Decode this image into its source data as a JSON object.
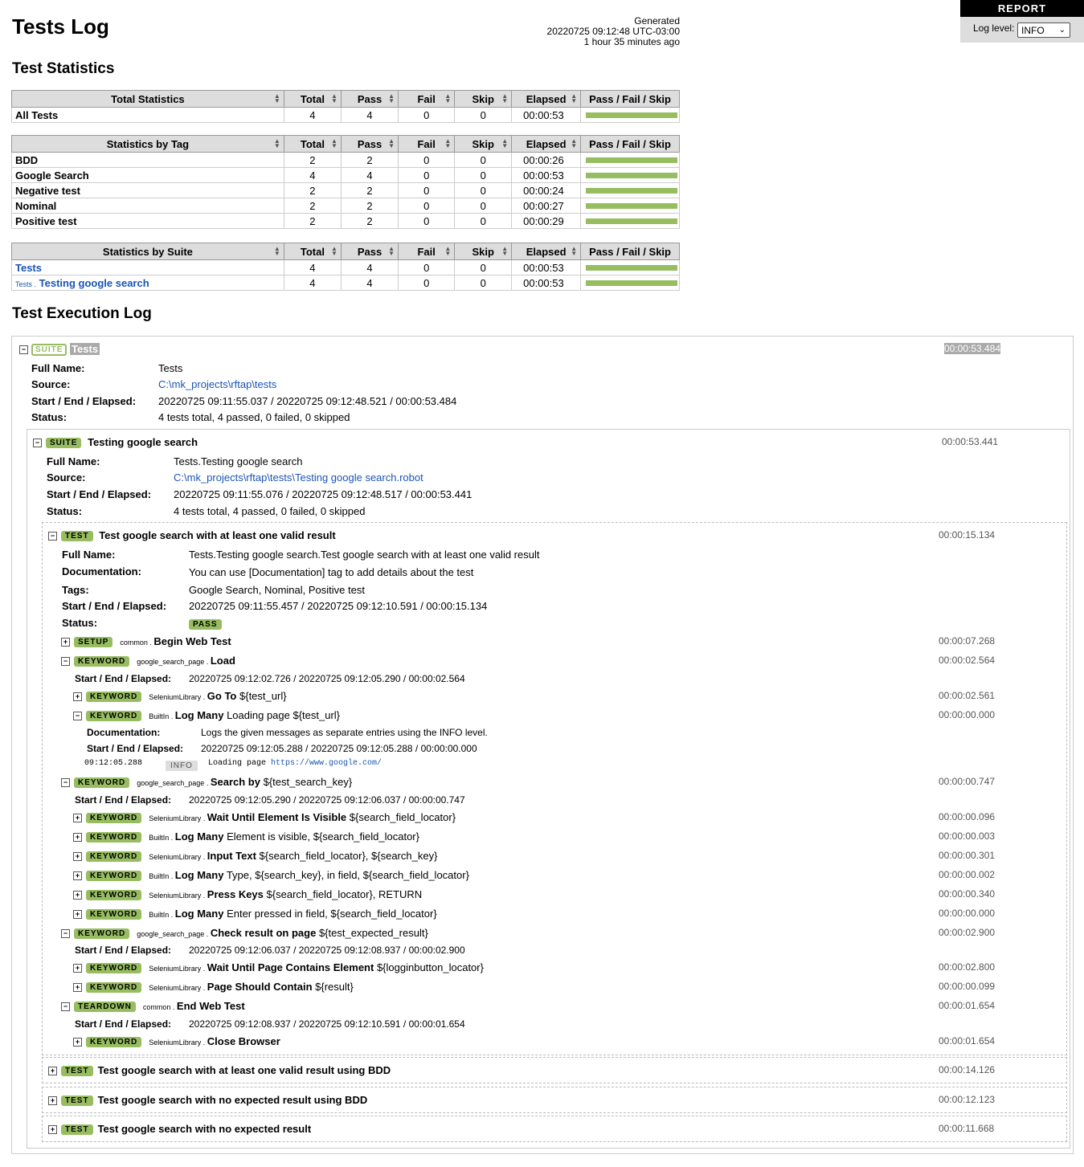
{
  "header": {
    "title": "Tests Log",
    "generated_label": "Generated",
    "generated_time": "20220725 09:12:48 UTC-03:00",
    "generated_ago": "1 hour 35 minutes ago",
    "report_link": "REPORT",
    "log_level_label": "Log level:",
    "log_level_value": "INFO"
  },
  "statistics": {
    "heading": "Test Statistics",
    "columns": [
      "Total",
      "Pass",
      "Fail",
      "Skip",
      "Elapsed",
      "Pass / Fail / Skip"
    ],
    "total": {
      "heading": "Total Statistics",
      "rows": [
        {
          "name": "All Tests",
          "total": "4",
          "pass": "4",
          "fail": "0",
          "skip": "0",
          "elapsed": "00:00:53",
          "pass_ratio": 1.0
        }
      ]
    },
    "by_tag": {
      "heading": "Statistics by Tag",
      "rows": [
        {
          "name": "BDD",
          "total": "2",
          "pass": "2",
          "fail": "0",
          "skip": "0",
          "elapsed": "00:00:26",
          "pass_ratio": 1.0
        },
        {
          "name": "Google Search",
          "total": "4",
          "pass": "4",
          "fail": "0",
          "skip": "0",
          "elapsed": "00:00:53",
          "pass_ratio": 1.0
        },
        {
          "name": "Negative test",
          "total": "2",
          "pass": "2",
          "fail": "0",
          "skip": "0",
          "elapsed": "00:00:24",
          "pass_ratio": 1.0
        },
        {
          "name": "Nominal",
          "total": "2",
          "pass": "2",
          "fail": "0",
          "skip": "0",
          "elapsed": "00:00:27",
          "pass_ratio": 1.0
        },
        {
          "name": "Positive test",
          "total": "2",
          "pass": "2",
          "fail": "0",
          "skip": "0",
          "elapsed": "00:00:29",
          "pass_ratio": 1.0
        }
      ]
    },
    "by_suite": {
      "heading": "Statistics by Suite",
      "rows": [
        {
          "prefix": "",
          "name": "Tests",
          "total": "4",
          "pass": "4",
          "fail": "0",
          "skip": "0",
          "elapsed": "00:00:53",
          "pass_ratio": 1.0
        },
        {
          "prefix": "Tests .",
          "name": "Testing google search",
          "total": "4",
          "pass": "4",
          "fail": "0",
          "skip": "0",
          "elapsed": "00:00:53",
          "pass_ratio": 1.0
        }
      ]
    }
  },
  "log": {
    "heading": "Test Execution Log",
    "suite_label": "SUITE",
    "test_label": "TEST",
    "keyword_label": "KEYWORD",
    "setup_label": "SETUP",
    "teardown_label": "TEARDOWN",
    "pass_label": "PASS",
    "info_label": "INFO",
    "labels": {
      "full_name": "Full Name:",
      "source": "Source:",
      "start_end": "Start / End / Elapsed:",
      "status": "Status:",
      "documentation": "Documentation:",
      "tags": "Tags:"
    },
    "root_suite": {
      "name": "Tests",
      "elapsed": "00:00:53.484",
      "full_name": "Tests",
      "source": "C:\\mk_projects\\rftap\\tests",
      "start_end": "20220725 09:11:55.037 / 20220725 09:12:48.521 / 00:00:53.484",
      "status": "4 tests total, 4 passed, 0 failed, 0 skipped"
    },
    "suite": {
      "name": "Testing google search",
      "elapsed": "00:00:53.441",
      "full_name": "Tests.Testing google search",
      "source": "C:\\mk_projects\\rftap\\tests\\Testing google search.robot",
      "start_end": "20220725 09:11:55.076 / 20220725 09:12:48.517 / 00:00:53.441",
      "status": "4 tests total, 4 passed, 0 failed, 0 skipped"
    },
    "test1": {
      "name": "Test google search with at least one valid result",
      "elapsed": "00:00:15.134",
      "full_name": "Tests.Testing google search.Test google search with at least one valid result",
      "documentation": "You can use [Documentation] tag to add details about the test",
      "tags": "Google Search, Nominal, Positive test",
      "start_end": "20220725 09:11:55.457 / 20220725 09:12:10.591 / 00:00:15.134"
    },
    "setup": {
      "lib": "common",
      "name": "Begin Web Test",
      "args": "",
      "elapsed": "00:00:07.268"
    },
    "kw_load": {
      "lib": "google_search_page",
      "name": "Load",
      "args": "",
      "elapsed": "00:00:02.564",
      "start_end": "20220725 09:12:02.726 / 20220725 09:12:05.290 / 00:00:02.564"
    },
    "kw_goto": {
      "lib": "SeleniumLibrary",
      "name": "Go To",
      "args": "${test_url}",
      "elapsed": "00:00:02.561"
    },
    "kw_logmany1": {
      "lib": "BuiltIn",
      "name": "Log Many",
      "args": "Loading page ${test_url}",
      "elapsed": "00:00:00.000",
      "documentation": "Logs the given messages as separate entries using the INFO level.",
      "start_end": "20220725 09:12:05.288 / 20220725 09:12:05.288 / 00:00:00.000",
      "msg_time": "09:12:05.288",
      "msg_text": "Loading page",
      "msg_link": "https://www.google.com/"
    },
    "kw_search": {
      "lib": "google_search_page",
      "name": "Search by",
      "args": "${test_search_key}",
      "elapsed": "00:00:00.747",
      "start_end": "20220725 09:12:05.290 / 20220725 09:12:06.037 / 00:00:00.747"
    },
    "search_children": [
      {
        "lib": "SeleniumLibrary",
        "name": "Wait Until Element Is Visible",
        "args": "${search_field_locator}",
        "elapsed": "00:00:00.096"
      },
      {
        "lib": "BuiltIn",
        "name": "Log Many",
        "args": "Element is visible, ${search_field_locator}",
        "elapsed": "00:00:00.003"
      },
      {
        "lib": "SeleniumLibrary",
        "name": "Input Text",
        "args": "${search_field_locator}, ${search_key}",
        "elapsed": "00:00:00.301"
      },
      {
        "lib": "BuiltIn",
        "name": "Log Many",
        "args": "Type, ${search_key}, in field, ${search_field_locator}",
        "elapsed": "00:00:00.002"
      },
      {
        "lib": "SeleniumLibrary",
        "name": "Press Keys",
        "args": "${search_field_locator}, RETURN",
        "elapsed": "00:00:00.340"
      },
      {
        "lib": "BuiltIn",
        "name": "Log Many",
        "args": "Enter pressed in field, ${search_field_locator}",
        "elapsed": "00:00:00.000"
      }
    ],
    "kw_check": {
      "lib": "google_search_page",
      "name": "Check result on page",
      "args": "${test_expected_result}",
      "elapsed": "00:00:02.900",
      "start_end": "20220725 09:12:06.037 / 20220725 09:12:08.937 / 00:00:02.900"
    },
    "check_children": [
      {
        "lib": "SeleniumLibrary",
        "name": "Wait Until Page Contains Element",
        "args": "${logginbutton_locator}",
        "elapsed": "00:00:02.800"
      },
      {
        "lib": "SeleniumLibrary",
        "name": "Page Should Contain",
        "args": "${result}",
        "elapsed": "00:00:00.099"
      }
    ],
    "teardown": {
      "lib": "common",
      "name": "End Web Test",
      "args": "",
      "elapsed": "00:00:01.654",
      "start_end": "20220725 09:12:08.937 / 20220725 09:12:10.591 / 00:00:01.654"
    },
    "kw_close": {
      "lib": "SeleniumLibrary",
      "name": "Close Browser",
      "args": "",
      "elapsed": "00:00:01.654"
    },
    "other_tests": [
      {
        "name": "Test google search with at least one valid result using BDD",
        "elapsed": "00:00:14.126"
      },
      {
        "name": "Test google search with no expected result using BDD",
        "elapsed": "00:00:12.123"
      },
      {
        "name": "Test google search with no expected result",
        "elapsed": "00:00:11.668"
      }
    ]
  },
  "colors": {
    "pass": "#97bd61",
    "link": "#1a55b4",
    "header_bg": "#dddddd"
  }
}
